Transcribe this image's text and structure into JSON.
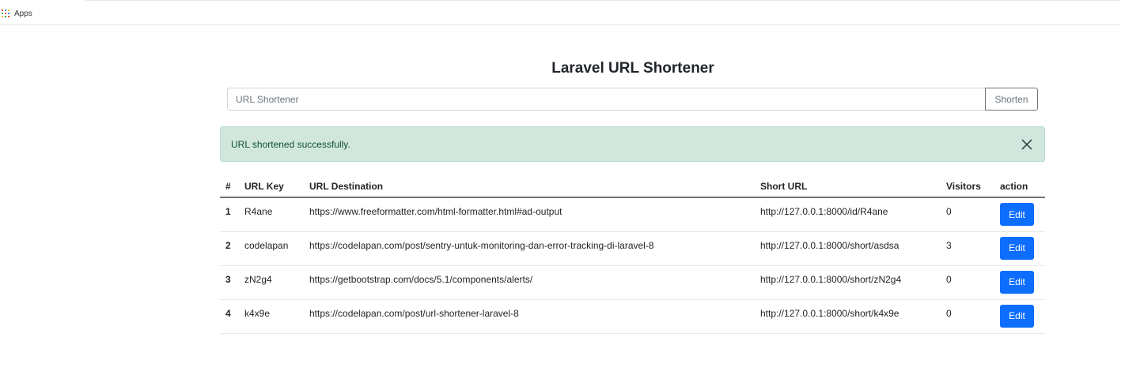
{
  "bookmarks": {
    "apps_label": "Apps"
  },
  "page": {
    "title": "Laravel URL Shortener"
  },
  "form": {
    "placeholder": "URL Shortener",
    "submit_label": "Shorten"
  },
  "alert": {
    "message": "URL shortened successfully."
  },
  "table": {
    "headers": [
      "#",
      "URL Key",
      "URL Destination",
      "Short URL",
      "Visitors",
      "action"
    ],
    "rows": [
      {
        "num": "1",
        "key": "R4ane",
        "destination": "https://www.freeformatter.com/html-formatter.html#ad-output",
        "short_url": "http://127.0.0.1:8000/id/R4ane",
        "visitors": "0",
        "action": "Edit"
      },
      {
        "num": "2",
        "key": "codelapan",
        "destination": "https://codelapan.com/post/sentry-untuk-monitoring-dan-error-tracking-di-laravel-8",
        "short_url": "http://127.0.0.1:8000/short/asdsa",
        "visitors": "3",
        "action": "Edit"
      },
      {
        "num": "3",
        "key": "zN2g4",
        "destination": "https://getbootstrap.com/docs/5.1/components/alerts/",
        "short_url": "http://127.0.0.1:8000/short/zN2g4",
        "visitors": "0",
        "action": "Edit"
      },
      {
        "num": "4",
        "key": "k4x9e",
        "destination": "https://codelapan.com/post/url-shortener-laravel-8",
        "short_url": "http://127.0.0.1:8000/short/k4x9e",
        "visitors": "0",
        "action": "Edit"
      }
    ]
  },
  "icons": {
    "apps": "apps-grid-icon",
    "close": "close-icon"
  },
  "colors": {
    "primary": "#0d6efd",
    "alert_bg": "#d1e7dd",
    "alert_text": "#0f5132"
  }
}
